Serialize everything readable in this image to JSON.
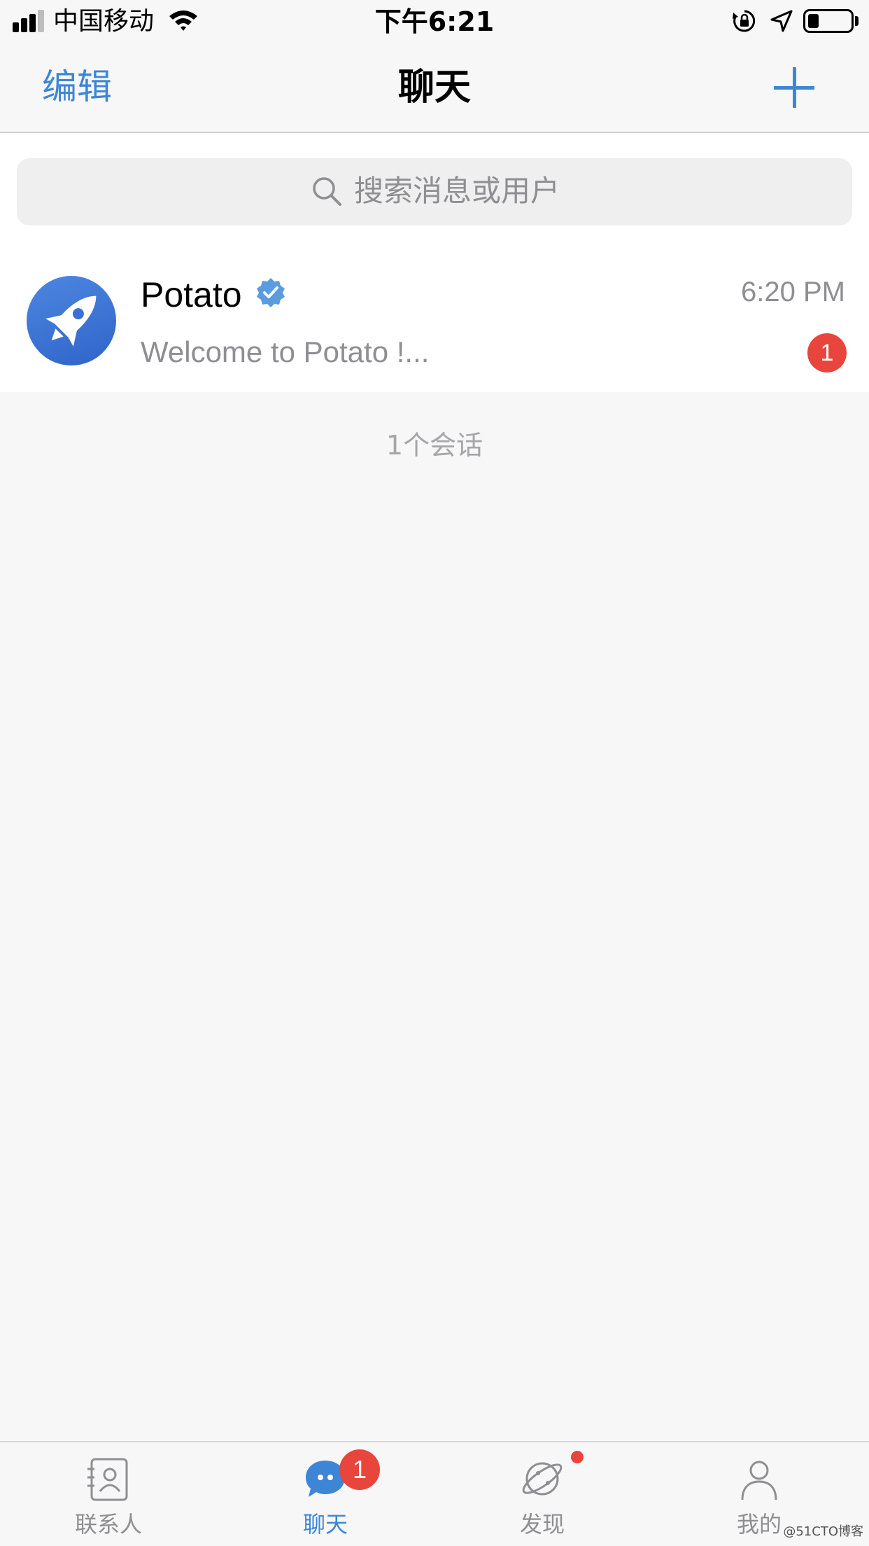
{
  "status_bar": {
    "carrier": "中国移动",
    "time": "下午6:21",
    "signal_bars": 3,
    "battery_level": 0.25,
    "icons": [
      "signal-icon",
      "wifi-icon",
      "rotation-lock-icon",
      "location-icon",
      "battery-icon"
    ]
  },
  "nav": {
    "edit_label": "编辑",
    "title": "聊天",
    "add_icon": "plus-icon"
  },
  "search": {
    "placeholder": "搜索消息或用户"
  },
  "chats": [
    {
      "name": "Potato",
      "verified": true,
      "time": "6:20 PM",
      "preview": "Welcome to Potato !...",
      "unread": "1",
      "avatar_icon": "rocket-icon"
    }
  ],
  "session_count": "1个会话",
  "tabs": [
    {
      "label": "联系人",
      "icon": "contacts-icon",
      "active": false,
      "badge": ""
    },
    {
      "label": "聊天",
      "icon": "chat-bubble-icon",
      "active": true,
      "badge": "1"
    },
    {
      "label": "发现",
      "icon": "planet-icon",
      "active": false,
      "dot": true
    },
    {
      "label": "我的",
      "icon": "profile-icon",
      "active": false,
      "badge": ""
    }
  ],
  "watermark": "@51CTO博客",
  "colors": {
    "accent": "#3d86d6",
    "badge": "#e8453c",
    "background": "#f7f7f7",
    "secondary_text": "#8e8e93"
  }
}
